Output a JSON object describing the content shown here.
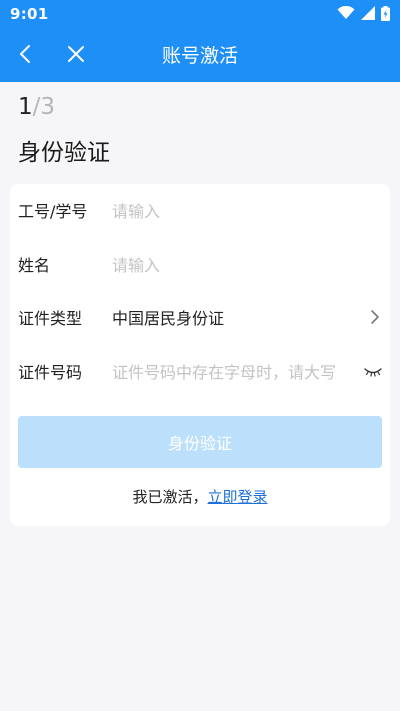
{
  "status_bar": {
    "time": "9:01"
  },
  "nav": {
    "title": "账号激活"
  },
  "step": {
    "current": "1",
    "total": "/3"
  },
  "heading": "身份验证",
  "form": {
    "rows": [
      {
        "label": "工号/学号",
        "placeholder": "请输入"
      },
      {
        "label": "姓名",
        "placeholder": "请输入"
      },
      {
        "label": "证件类型",
        "value": "中国居民身份证"
      },
      {
        "label": "证件号码",
        "placeholder": "证件号码中存在字母时，请大写"
      }
    ],
    "submit_label": "身份验证",
    "login_prompt": "我已激活，",
    "login_link": "立即登录"
  },
  "colors": {
    "primary": "#1e8ff7",
    "button_disabled": "#bcdffb",
    "link": "#1e6fd9",
    "background": "#f6f6f8"
  },
  "icons": [
    "wifi-icon",
    "signal-icon",
    "battery-icon",
    "back-icon",
    "close-icon",
    "chevron-right-icon",
    "eye-closed-icon"
  ]
}
